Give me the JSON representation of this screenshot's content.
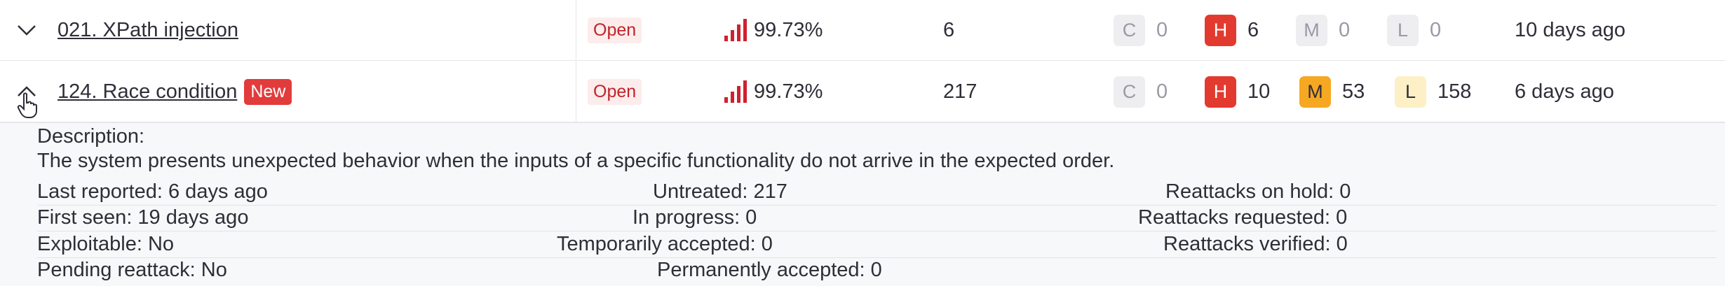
{
  "rows": [
    {
      "toggle_icon": "chevron-down-icon",
      "name": "021. XPath injection",
      "badge": "",
      "status": "Open",
      "probability": "99.73%",
      "vulnerabilities": "6",
      "severity": {
        "c": {
          "label": "C",
          "count": "0"
        },
        "h": {
          "label": "H",
          "count": "6"
        },
        "m": {
          "label": "M",
          "count": "0"
        },
        "l": {
          "label": "L",
          "count": "0"
        }
      },
      "last_reported": "10 days ago"
    },
    {
      "toggle_icon": "chevron-up-icon",
      "name": "124. Race condition",
      "badge": "New",
      "status": "Open",
      "probability": "99.73%",
      "vulnerabilities": "217",
      "severity": {
        "c": {
          "label": "C",
          "count": "0"
        },
        "h": {
          "label": "H",
          "count": "10"
        },
        "m": {
          "label": "M",
          "count": "53"
        },
        "l": {
          "label": "L",
          "count": "158"
        }
      },
      "last_reported": "6 days ago"
    }
  ],
  "details": {
    "description_label": "Description:",
    "description": "The system presents unexpected behavior when the inputs of a specific functionality do not arrive in the expected order.",
    "stats": [
      [
        "Last reported: 6 days ago",
        "Untreated: 217",
        "Reattacks on hold: 0"
      ],
      [
        "First seen: 19 days ago",
        "In progress: 0",
        "Reattacks requested: 0"
      ],
      [
        "Exploitable: No",
        "Temporarily accepted: 0",
        "Reattacks verified: 0"
      ],
      [
        "Pending reattack: No",
        "Permanently accepted: 0",
        ""
      ]
    ]
  },
  "colors": {
    "open_text": "#c0242b",
    "open_bg": "#fdecec",
    "high": "#e33a2f",
    "medium": "#f6a823",
    "low": "#fdf0c6",
    "new_badge": "#e23b3b",
    "signal_bar": "#d0202e"
  }
}
